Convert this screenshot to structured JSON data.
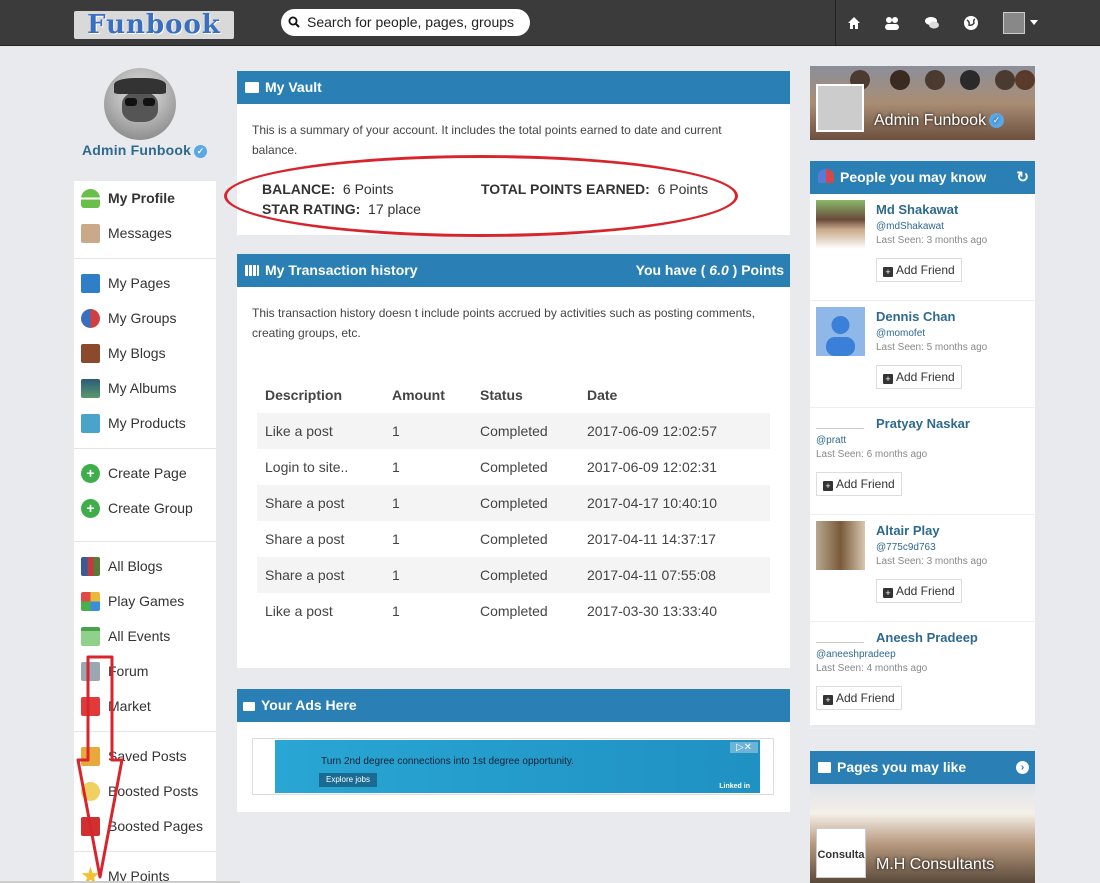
{
  "header": {
    "logo": "Funbook",
    "search_placeholder": "Search for people, pages, groups",
    "nav_icons": [
      "home-icon",
      "friends-icon",
      "chat-icon",
      "globe-icon"
    ]
  },
  "profile": {
    "name": "Admin Funbook"
  },
  "sidebar": {
    "items": [
      {
        "label": "My Profile",
        "bold": true
      },
      {
        "label": "Messages"
      },
      {
        "label": "My Pages"
      },
      {
        "label": "My Groups"
      },
      {
        "label": "My Blogs"
      },
      {
        "label": "My Albums"
      },
      {
        "label": "My Products"
      },
      {
        "label": "Create Page"
      },
      {
        "label": "Create Group"
      },
      {
        "label": "All Blogs"
      },
      {
        "label": "Play Games"
      },
      {
        "label": "All Events"
      },
      {
        "label": "Forum"
      },
      {
        "label": "Market"
      },
      {
        "label": "Saved Posts"
      },
      {
        "label": "Boosted Posts"
      },
      {
        "label": "Boosted Pages"
      },
      {
        "label": "My Points"
      }
    ]
  },
  "vault": {
    "title": "My Vault",
    "description": "This is a summary of your account. It includes the total points earned to date and current balance.",
    "balance_label": "BALANCE:",
    "balance_value": "6 Points",
    "total_label": "TOTAL POINTS EARNED:",
    "total_value": "6 Points",
    "star_label": "STAR RATING:",
    "star_value": "17 place"
  },
  "transactions": {
    "title": "My Transaction history",
    "you_have_prefix": "You have (",
    "you_have_value": "6.0",
    "you_have_suffix": ") Points",
    "description": "This transaction history doesn t include points accrued by activities such as posting comments, creating groups, etc.",
    "columns": [
      "Description",
      "Amount",
      "Status",
      "Date"
    ],
    "rows": [
      [
        "Like a post",
        "1",
        "Completed",
        "2017-06-09 12:02:57"
      ],
      [
        "Login to site..",
        "1",
        "Completed",
        "2017-06-09 12:02:31"
      ],
      [
        "Share a post",
        "1",
        "Completed",
        "2017-04-17 10:40:10"
      ],
      [
        "Share a post",
        "1",
        "Completed",
        "2017-04-11 14:37:17"
      ],
      [
        "Share a post",
        "1",
        "Completed",
        "2017-04-11 07:55:08"
      ],
      [
        "Like a post",
        "1",
        "Completed",
        "2017-03-30 13:33:40"
      ]
    ]
  },
  "ads": {
    "title": "Your Ads Here",
    "ad_text": "Turn 2nd degree connections into 1st degree opportunity.",
    "ad_button": "Explore jobs",
    "ad_brand": "Linked in"
  },
  "cover": {
    "name": "Admin Funbook"
  },
  "people": {
    "title": "People you may know",
    "add_label": "Add Friend",
    "list": [
      {
        "name": "Md Shakawat",
        "handle": "@mdShakawat",
        "seen": "Last Seen: 3 months ago"
      },
      {
        "name": "Dennis Chan",
        "handle": "@momofet",
        "seen": "Last Seen: 5 months ago"
      },
      {
        "name": "Pratyay Naskar",
        "handle": "@pratt",
        "seen": "Last Seen: 6 months ago"
      },
      {
        "name": "Altair Play",
        "handle": "@775c9d763",
        "seen": "Last Seen: 3 months ago"
      },
      {
        "name": "Aneesh Pradeep",
        "handle": "@aneeshpradeep",
        "seen": "Last Seen: 4 months ago"
      }
    ]
  },
  "pages_like": {
    "title": "Pages you may like",
    "page_name": "M.H Consultants",
    "page_logo_text": "Consulta"
  },
  "colors": {
    "header_blue": "#2a7fb4",
    "topbar": "#3b3b3b",
    "annotation_red": "#d8242d",
    "link": "#2e6a8e"
  }
}
